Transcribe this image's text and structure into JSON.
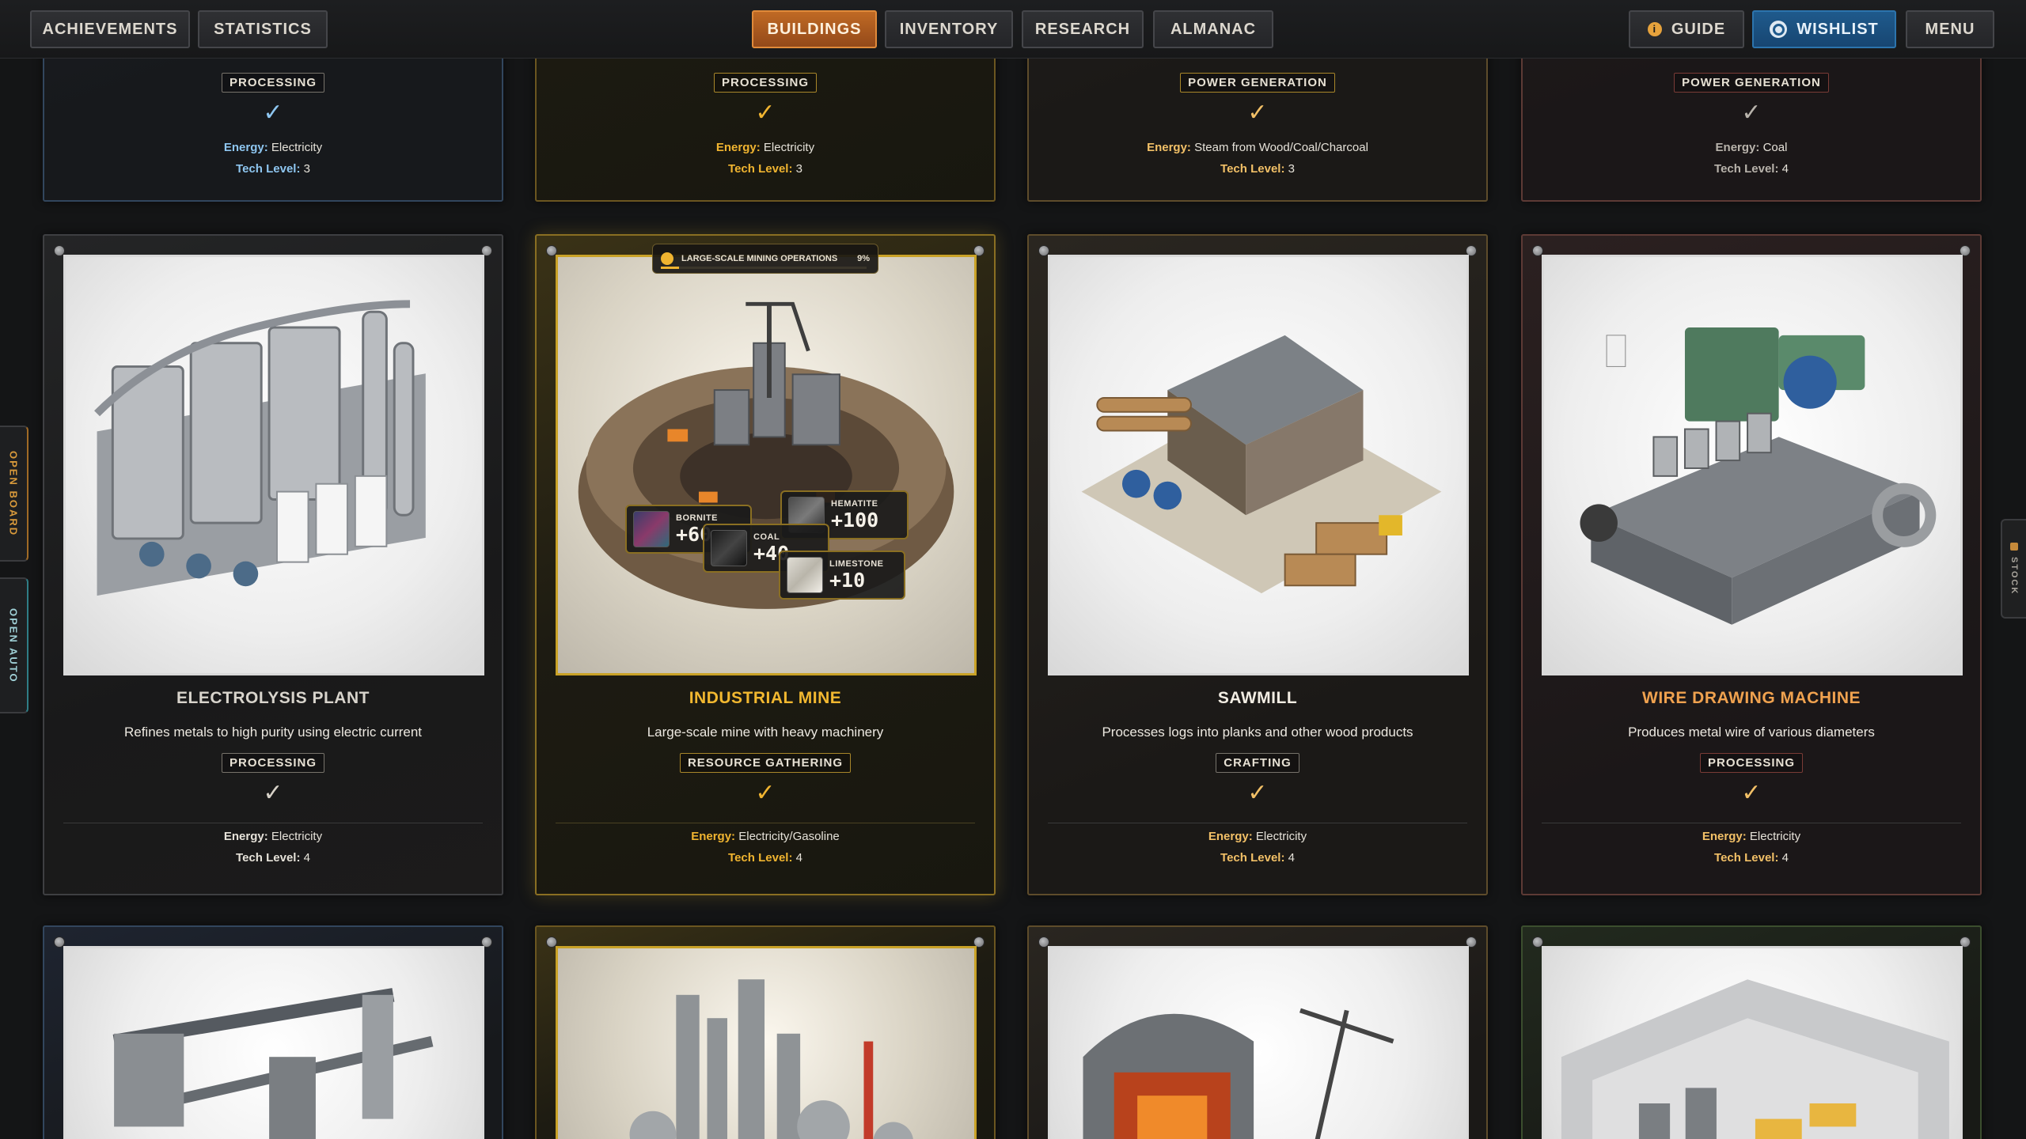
{
  "nav": {
    "left": [
      "ACHIEVEMENTS",
      "STATISTICS"
    ],
    "center": [
      "BUILDINGS",
      "INVENTORY",
      "RESEARCH",
      "ALMANAC"
    ],
    "active": "BUILDINGS",
    "guide": "GUIDE",
    "wishlist": "WISHLIST",
    "menu": "MENU"
  },
  "side_tabs": {
    "board": "OPEN BOARD",
    "auto": "OPEN AUTO",
    "stock": "STOCK"
  },
  "top_cards": [
    {
      "category": "PROCESSING",
      "energy_label": "Energy:",
      "energy": "Electricity",
      "tech_label": "Tech Level:",
      "tech": "3",
      "theme": "blue"
    },
    {
      "category": "PROCESSING",
      "energy_label": "Energy:",
      "energy": "Electricity",
      "tech_label": "Tech Level:",
      "tech": "3",
      "theme": "gold"
    },
    {
      "category": "POWER GENERATION",
      "energy_label": "Energy:",
      "energy": "Steam from Wood/Coal/Charcoal",
      "tech_label": "Tech Level:",
      "tech": "3",
      "theme": "amber"
    },
    {
      "category": "POWER GENERATION",
      "energy_label": "Energy:",
      "energy": "Coal",
      "tech_label": "Tech Level:",
      "tech": "4",
      "theme": "red"
    }
  ],
  "cards": [
    {
      "name": "ELECTROLYSIS PLANT",
      "description": "Refines metals to high purity using electric current",
      "category": "PROCESSING",
      "check": "✓",
      "energy_label": "Energy:",
      "energy": "Electricity",
      "tech_label": "Tech Level:",
      "tech": "4"
    },
    {
      "name": "INDUSTRIAL MINE",
      "description": "Large-scale mine with heavy machinery",
      "category": "RESOURCE GATHERING",
      "check": "✓",
      "energy_label": "Energy:",
      "energy": "Electricity/Gasoline",
      "tech_label": "Tech Level:",
      "tech": "4"
    },
    {
      "name": "SAWMILL",
      "description": "Processes logs into planks and other wood products",
      "category": "CRAFTING",
      "check": "✓",
      "energy_label": "Energy:",
      "energy": "Electricity",
      "tech_label": "Tech Level:",
      "tech": "4"
    },
    {
      "name": "WIRE DRAWING MACHINE",
      "description": "Produces metal wire of various diameters",
      "category": "PROCESSING",
      "check": "✓",
      "energy_label": "Energy:",
      "energy": "Electricity",
      "tech_label": "Tech Level:",
      "tech": "4"
    }
  ],
  "mine_overlay": {
    "operation": "LARGE-SCALE MINING OPERATIONS",
    "percent": "9%",
    "progress_fraction": 0.09,
    "resources": [
      {
        "name": "BORNITE",
        "amount": "+60"
      },
      {
        "name": "HEMATITE",
        "amount": "+100"
      },
      {
        "name": "COAL",
        "amount": "+40"
      },
      {
        "name": "LIMESTONE",
        "amount": "+10"
      }
    ]
  },
  "colors": {
    "accent_active": "#c06a24",
    "wishlist": "#1f5a8c",
    "gold": "#f0b430",
    "blue_label": "#8ec6f0"
  }
}
